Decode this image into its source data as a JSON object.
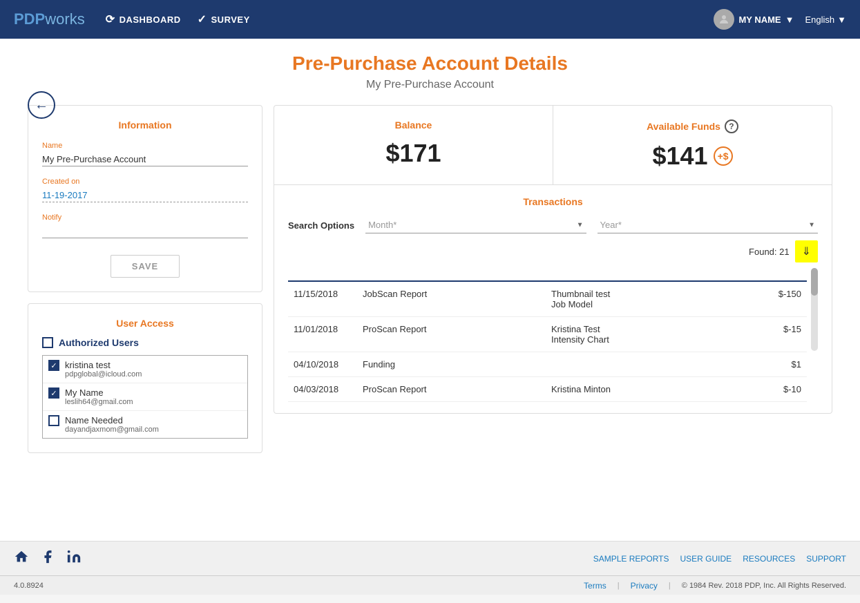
{
  "header": {
    "logo_pdp": "PDP",
    "logo_works": "works",
    "nav_dashboard": "DASHBOARD",
    "nav_survey": "SURVEY",
    "user_name": "MY NAME",
    "lang": "English"
  },
  "page": {
    "title": "Pre-Purchase Account Details",
    "subtitle": "My Pre-Purchase Account"
  },
  "info_card": {
    "title": "Information",
    "name_label": "Name",
    "name_value": "My Pre-Purchase Account",
    "created_label": "Created on",
    "created_value": "11-19-2017",
    "notify_label": "Notify",
    "save_label": "SAVE"
  },
  "user_access": {
    "title": "User Access",
    "authorized_users_label": "Authorized Users",
    "users": [
      {
        "name": "kristina test",
        "email": "pdpglobal@icloud.com",
        "checked": true
      },
      {
        "name": "My Name",
        "email": "leslih64@gmail.com",
        "checked": true
      },
      {
        "name": "Name Needed",
        "email": "dayandjaxmom@gmail.com",
        "checked": false
      }
    ]
  },
  "balance": {
    "title": "Balance",
    "amount": "$171",
    "available_title": "Available Funds",
    "available_amount": "$141",
    "add_funds_label": "+$"
  },
  "transactions": {
    "title": "Transactions",
    "search_options_label": "Search Options",
    "month_placeholder": "Month*",
    "year_placeholder": "Year*",
    "found_label": "Found: 21",
    "rows": [
      {
        "date": "11/15/2018",
        "type": "JobScan Report",
        "name": "Thumbnail test\nJob Model",
        "amount": "$-150"
      },
      {
        "date": "11/01/2018",
        "type": "ProScan Report",
        "name": "Kristina Test\nIntensity Chart",
        "amount": "$-15"
      },
      {
        "date": "04/10/2018",
        "type": "Funding",
        "name": "",
        "amount": "$1"
      },
      {
        "date": "04/03/2018",
        "type": "ProScan Report",
        "name": "Kristina Minton",
        "amount": "$-10"
      }
    ]
  },
  "footer": {
    "sample_reports": "SAMPLE REPORTS",
    "user_guide": "USER GUIDE",
    "resources": "RESOURCES",
    "support": "SUPPORT",
    "version": "4.0.8924",
    "terms": "Terms",
    "privacy": "Privacy",
    "copyright": "© 1984 Rev. 2018 PDP, Inc. All Rights Reserved."
  }
}
